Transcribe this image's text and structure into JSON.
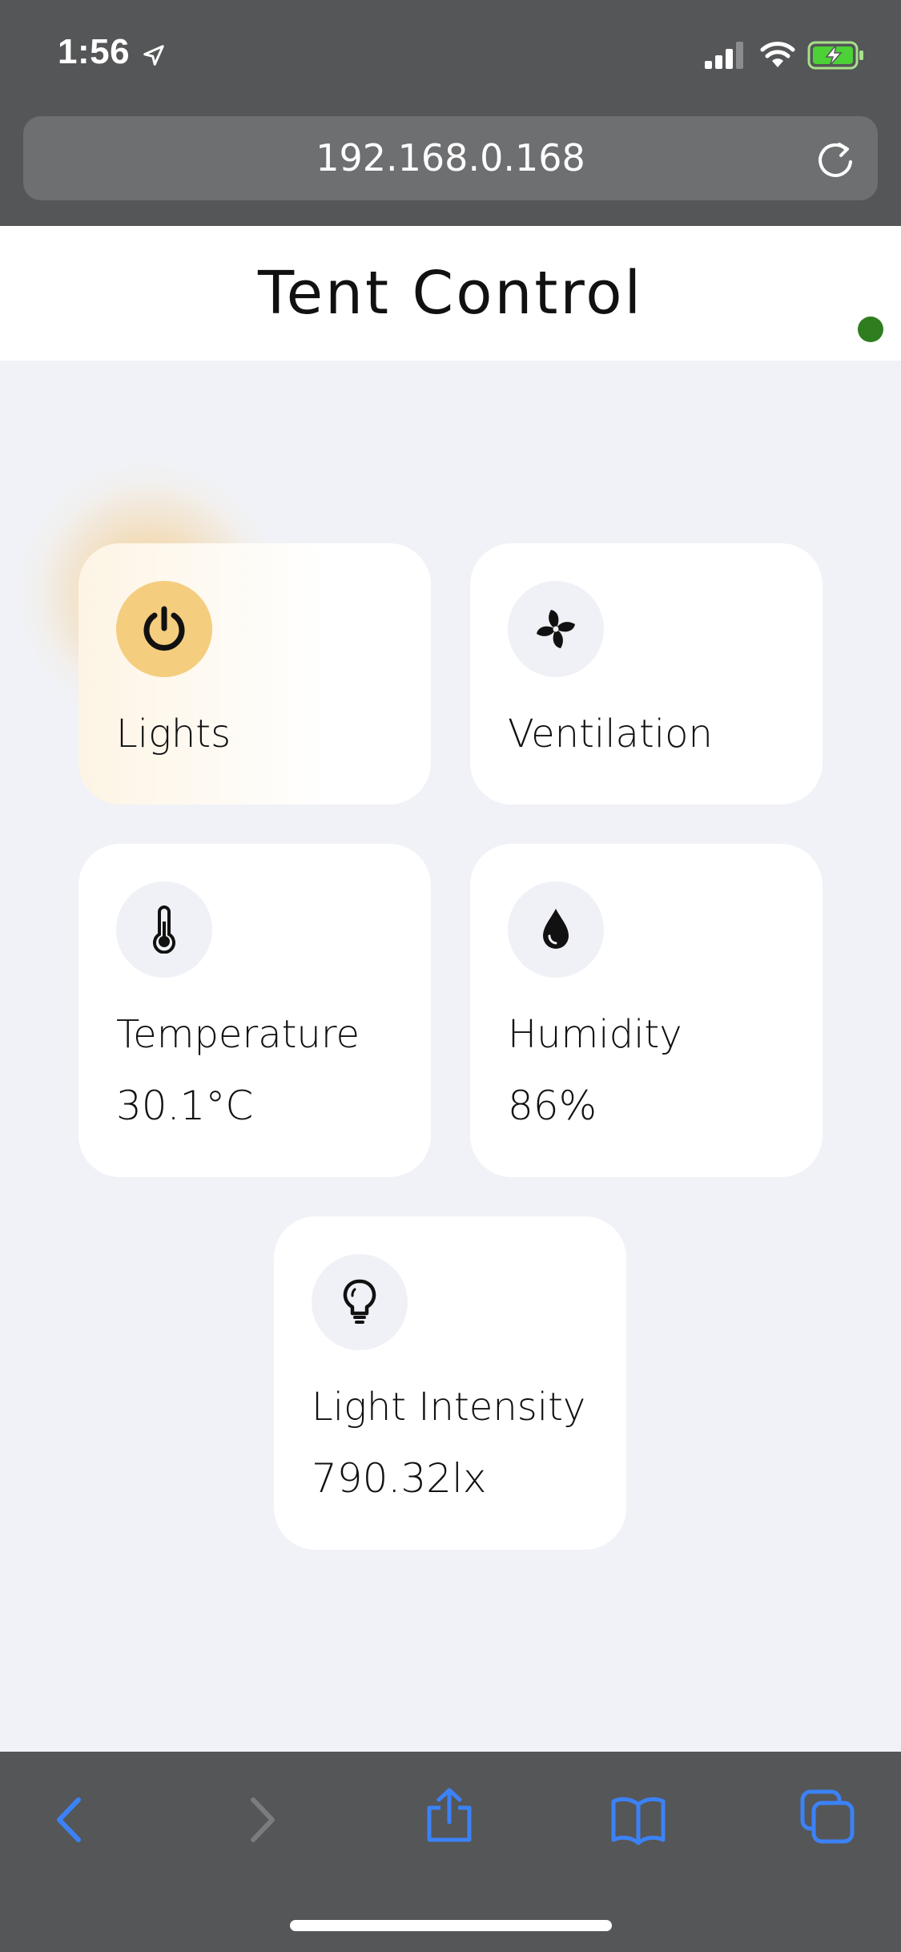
{
  "status_bar": {
    "time": "1:56",
    "icons": [
      "location-arrow-icon",
      "cellular-signal-icon",
      "wifi-icon",
      "battery-charging-icon"
    ]
  },
  "browser": {
    "url": "192.168.0.168",
    "reload_icon": "reload-icon"
  },
  "app": {
    "title": "Tent Control",
    "connection_status_color": "#2e7d1f"
  },
  "cards": {
    "lights": {
      "label": "Lights",
      "icon": "power-icon",
      "state": "on",
      "accent": "#f4cd7e"
    },
    "ventilation": {
      "label": "Ventilation",
      "icon": "fan-icon"
    },
    "temperature": {
      "label": "Temperature",
      "value": "30.1°C",
      "icon": "thermometer-icon"
    },
    "humidity": {
      "label": "Humidity",
      "value": "86%",
      "icon": "droplet-icon"
    },
    "light_intensity": {
      "label": "Light Intensity",
      "value": "790.32lx",
      "icon": "lightbulb-icon"
    }
  },
  "toolbar": {
    "icons": [
      "back-icon",
      "forward-icon",
      "share-icon",
      "bookmarks-icon",
      "tabs-icon"
    ],
    "accent": "#3b82f6"
  }
}
